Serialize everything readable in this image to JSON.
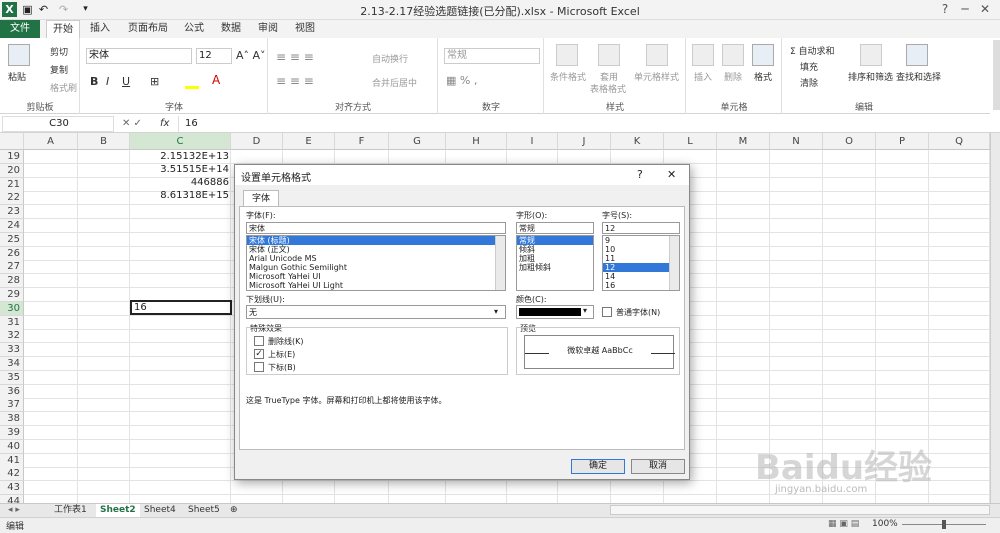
{
  "window": {
    "title": "2.13-2.17经验选题链接(已分配).xlsx - Microsoft Excel"
  },
  "ribbon_tabs": [
    "文件",
    "开始",
    "插入",
    "页面布局",
    "公式",
    "数据",
    "审阅",
    "视图"
  ],
  "ribbon": {
    "clipboard": {
      "paste": "粘贴",
      "cut": "剪切",
      "copy": "复制",
      "format_painter": "格式刷",
      "label": "剪贴板"
    },
    "font": {
      "name": "宋体",
      "size": "12",
      "label": "字体"
    },
    "alignment": {
      "wrap": "自动换行",
      "merge": "合并后居中",
      "label": "对齐方式"
    },
    "number": {
      "format": "常规",
      "label": "数字"
    },
    "styles": {
      "cond": "条件格式",
      "table": "套用表格格式",
      "cell": "单元格样式",
      "table_l1": "套用",
      "table_l2": "表格格式",
      "label": "样式"
    },
    "cells": {
      "insert": "插入",
      "delete": "删除",
      "format": "格式",
      "label": "单元格"
    },
    "editing": {
      "autosum": "Σ 自动求和",
      "fill": "填充",
      "clear": "清除",
      "sort": "排序和筛选",
      "find": "查找和选择",
      "label": "编辑"
    }
  },
  "formula_bar": {
    "name_box": "C30",
    "fx": "fx",
    "value": "16"
  },
  "columns": [
    "A",
    "B",
    "C",
    "D",
    "E",
    "F",
    "G",
    "H",
    "I",
    "J",
    "K",
    "L",
    "M",
    "N",
    "O",
    "P",
    "Q"
  ],
  "rows": [
    "19",
    "20",
    "21",
    "22",
    "23",
    "24",
    "25",
    "26",
    "27",
    "28",
    "29",
    "30",
    "31",
    "32",
    "33",
    "34",
    "35",
    "36",
    "37",
    "38",
    "39",
    "40",
    "41",
    "42",
    "43",
    "44"
  ],
  "cells": {
    "c19": "2.15132E+13",
    "c20": "3.51515E+14",
    "c21": "446886",
    "c22": "8.61318E+15",
    "c30": "16"
  },
  "sheets": [
    "工作表1",
    "Sheet2",
    "Sheet4",
    "Sheet5"
  ],
  "status": {
    "mode": "编辑",
    "zoom": "100%"
  },
  "dialog": {
    "title": "设置单元格格式",
    "help": "?",
    "close": "✕",
    "tab": "字体",
    "font_label": "字体(F):",
    "font_value": "宋体",
    "fonts": [
      "宋体 (标题)",
      "宋体 (正文)",
      "Arial Unicode MS",
      "Malgun Gothic Semilight",
      "Microsoft YaHei UI",
      "Microsoft YaHei UI Light"
    ],
    "style_label": "字形(O):",
    "style_value": "常规",
    "styles": [
      "常规",
      "倾斜",
      "加粗",
      "加粗倾斜"
    ],
    "size_label": "字号(S):",
    "size_value": "12",
    "sizes": [
      "9",
      "10",
      "11",
      "12",
      "14",
      "16"
    ],
    "underline_label": "下划线(U):",
    "underline_value": "无",
    "color_label": "颜色(C):",
    "normal_font": "普通字体(N)",
    "effects_label": "特殊效果",
    "strike": "删除线(K)",
    "superscript": "上标(E)",
    "subscript": "下标(B)",
    "preview_label": "预览",
    "preview_text": "微软卓越  AaBbCc",
    "info": "这是 TrueType 字体。屏幕和打印机上都将使用该字体。",
    "ok": "确定",
    "cancel": "取消"
  },
  "watermark": {
    "brand": "Baidu经验",
    "url": "jingyan.baidu.com"
  },
  "colors": {
    "excel_green": "#217346",
    "selection": "#3278d8"
  }
}
